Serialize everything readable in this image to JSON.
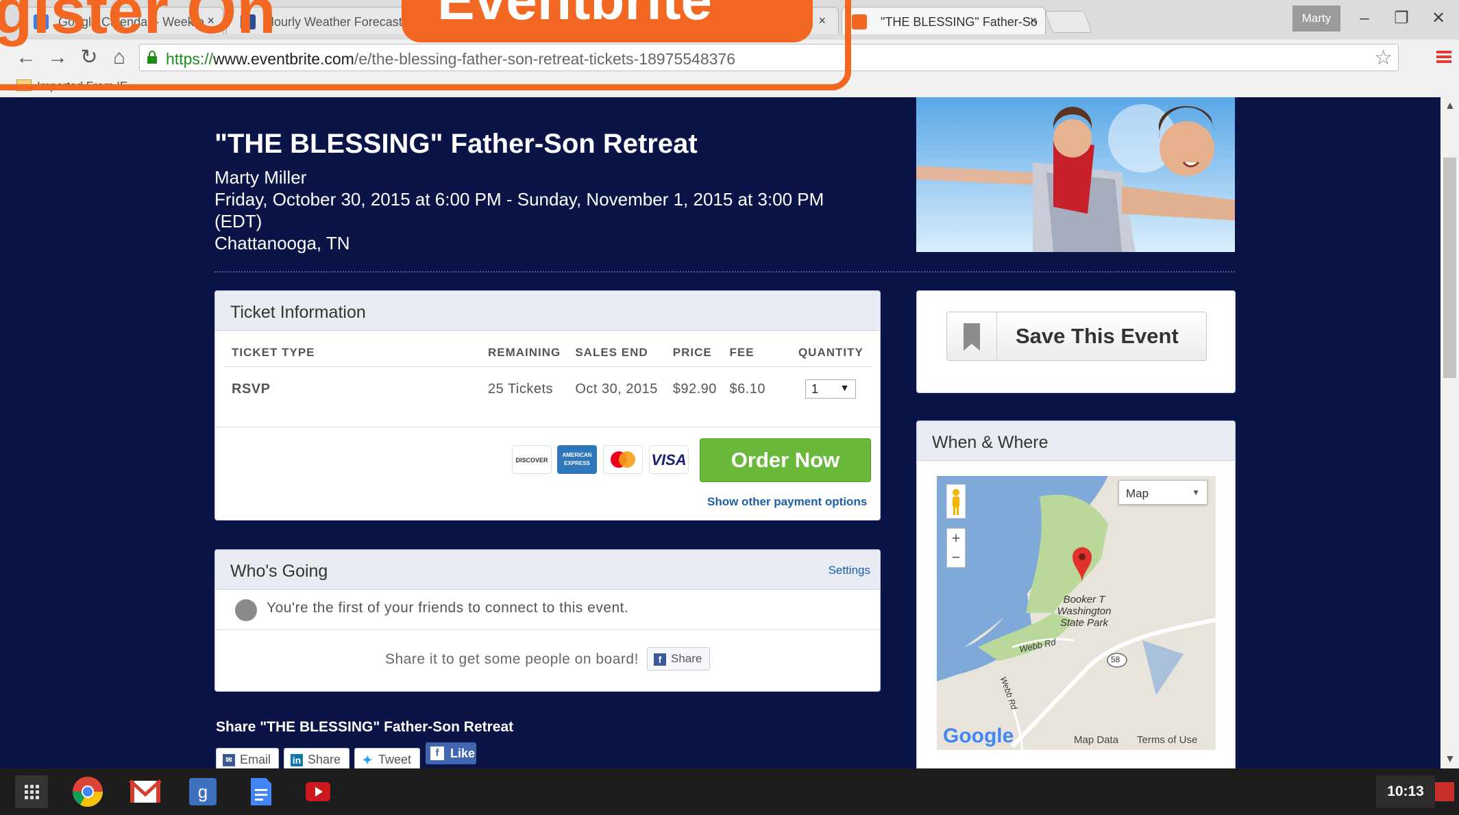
{
  "browser": {
    "tabs": [
      {
        "title": "Google Calendar - Week o"
      },
      {
        "title": "Hourly Weather Forecast"
      },
      {
        "title": ""
      },
      {
        "title": "\"THE BLESSING\" Father-So"
      }
    ],
    "profile": "Marty",
    "url": {
      "scheme": "https://",
      "host": "www.eventbrite.com",
      "path": "/e/the-blessing-father-son-retreat-tickets-18975548376"
    },
    "bookmark": "Imported From IE"
  },
  "overlay": {
    "banner_text": "Eventbrite",
    "left_text": "gister On"
  },
  "event": {
    "title": "\"THE BLESSING\" Father-Son Retreat",
    "organizer": "Marty Miller",
    "dates": "Friday, October 30, 2015 at 6:00 PM - Sunday, November 1, 2015 at 3:00 PM",
    "timezone": "(EDT)",
    "location": "Chattanooga, TN"
  },
  "tickets": {
    "heading": "Ticket Information",
    "columns": [
      "TICKET TYPE",
      "REMAINING",
      "SALES END",
      "PRICE",
      "FEE",
      "QUANTITY"
    ],
    "rows": [
      {
        "type": "RSVP",
        "remaining": "25 Tickets",
        "sales_end": "Oct 30, 2015",
        "price": "$92.90",
        "fee": "$6.10",
        "quantity": "1"
      }
    ],
    "cards": [
      "DISCOVER",
      "AMERICAN EXPRESS",
      "MasterCard",
      "VISA"
    ],
    "order_label": "Order Now",
    "payment_link": "Show other payment options"
  },
  "whos_going": {
    "heading": "Who's Going",
    "settings": "Settings",
    "friends_text": "You're the first of your friends to connect to this event.",
    "board_text": "Share it to get some people on board!",
    "share_label": "Share"
  },
  "share": {
    "title": "Share \"THE BLESSING\" Father-Son Retreat",
    "email": "Email",
    "linkedin": "Share",
    "tweet": "Tweet",
    "like": "Like"
  },
  "sidebar": {
    "save_label": "Save This Event",
    "when_where": "When & Where",
    "map_type": "Map",
    "zoom_in": "+",
    "zoom_out": "−",
    "park_label": "Booker T Washington State Park",
    "road_label": "Webb Rd",
    "road_label2": "Webb Rd",
    "route": "58",
    "google": "Google",
    "map_data": "Map Data",
    "terms": "Terms of Use"
  },
  "taskbar": {
    "clock": "10:13"
  },
  "colors": {
    "page_bg": "#0b1446",
    "order_green": "#6ab93a",
    "link_blue": "#1a5fa8",
    "overlay_orange": "#f26722"
  }
}
